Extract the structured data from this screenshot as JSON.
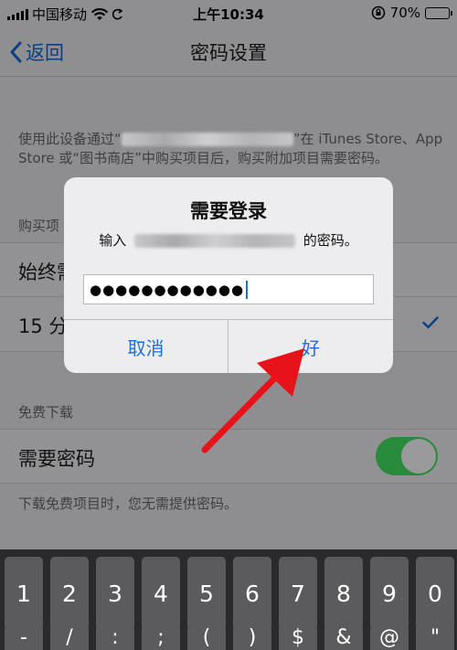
{
  "status_bar": {
    "carrier": "中国移动",
    "time": "上午10:34",
    "battery": "70%",
    "battery_level": 0.7,
    "icons": [
      "signal-icon",
      "wifi-icon",
      "sync-icon",
      "orientation-lock-icon",
      "battery-icon"
    ]
  },
  "nav": {
    "back_label": "返回",
    "title": "密码设置"
  },
  "settings": {
    "description_prefix": "使用此设备通过“",
    "description_suffix": "”在 iTunes Store、App Store 或“图书商店”中购买项目后，购买附加项目需要密码。",
    "purchases_header": "购买项",
    "option_always": "始终需",
    "option_15min": "15 分",
    "free_header": "免费下载",
    "require_password_label": "需要密码",
    "require_password_on": true,
    "footnote": "下载免费项目时，您无需提供密码。"
  },
  "dialog": {
    "title": "需要登录",
    "message_prefix": "输入",
    "message_suffix": "的密码。",
    "password_value": "●●●●●●●●●●●●",
    "cancel_label": "取消",
    "ok_label": "好"
  },
  "keyboard": {
    "number_row": [
      "1",
      "2",
      "3",
      "4",
      "5",
      "6",
      "7",
      "8",
      "9",
      "0"
    ],
    "symbol_row": [
      "-",
      "/",
      ":",
      ";",
      "(",
      ")",
      "$",
      "&",
      "@",
      "\""
    ]
  },
  "colors": {
    "accent_blue": "#1a6fdc",
    "annotation_red": "#e8131a",
    "toggle_green": "#2a8a3c"
  }
}
